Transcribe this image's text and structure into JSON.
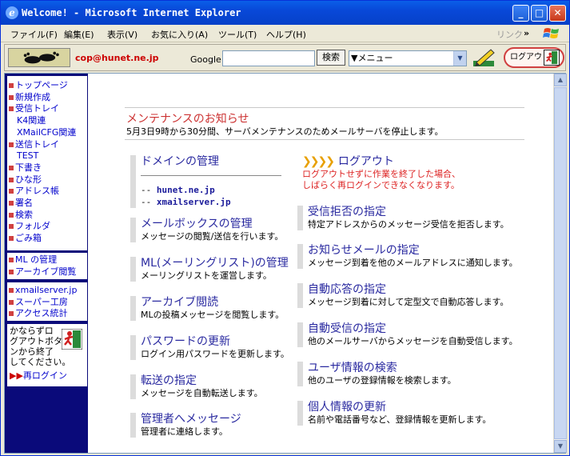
{
  "window": {
    "title": "Welcome! - Microsoft Internet Explorer"
  },
  "menubar": {
    "items": [
      "ファイル(F)",
      "編集(E)",
      "表示(V)",
      "お気に入り(A)",
      "ツール(T)",
      "ヘルプ(H)"
    ],
    "links_label": "リンク",
    "more": "»"
  },
  "toolbar": {
    "email": "cop@hunet.ne.jp",
    "google_label": "Google",
    "search_value": "",
    "search_button": "検索",
    "menu_select": "▼メニュー",
    "logout_label": "ログアウト"
  },
  "sidebar": {
    "group1": [
      {
        "label": "トップページ",
        "bullet": true
      },
      {
        "label": "新規作成",
        "bullet": true
      },
      {
        "label": "受信トレイ",
        "bullet": true
      },
      {
        "label": "K4関連",
        "bullet": false
      },
      {
        "label": "XMailCFG関連",
        "bullet": false
      },
      {
        "label": "送信トレイ",
        "bullet": true
      },
      {
        "label": "TEST",
        "bullet": false
      },
      {
        "label": "下書き",
        "bullet": true
      },
      {
        "label": "ひな形",
        "bullet": true
      },
      {
        "label": "アドレス帳",
        "bullet": true
      },
      {
        "label": "署名",
        "bullet": true
      },
      {
        "label": "検索",
        "bullet": true
      },
      {
        "label": "フォルダ",
        "bullet": true
      },
      {
        "label": "ごみ箱",
        "bullet": true
      }
    ],
    "group2": [
      {
        "label": "ML の管理",
        "bullet": true
      },
      {
        "label": "アーカイブ閲覧",
        "bullet": true
      }
    ],
    "group3": [
      {
        "label": "xmailserver.jp",
        "bullet": true
      },
      {
        "label": "スーパー工房",
        "bullet": true
      },
      {
        "label": "アクセス統計",
        "bullet": true
      }
    ],
    "note_lines": [
      "かならずロ",
      "グアウトボタ",
      "ンから終了",
      "してください。"
    ],
    "relogin_arrow": "▶▶",
    "relogin": "再ログイン"
  },
  "notice": {
    "title": "メンテナンスのお知らせ",
    "text": "5月3日9時から30分間、サーバメンテナンスのためメールサーバを停止します。"
  },
  "left_sections": [
    {
      "title": "ドメインの管理",
      "desc": ""
    },
    {
      "title": "メールボックスの管理",
      "desc": "メッセージの閲覧/送信を行います。"
    },
    {
      "title": "ML(メーリングリスト)の管理",
      "desc": "メーリングリストを運営します。"
    },
    {
      "title": "アーカイブ閲読",
      "desc": "MLの投稿メッセージを閲覧します。"
    },
    {
      "title": "パスワードの更新",
      "desc": "ログイン用パスワードを更新します。"
    },
    {
      "title": "転送の指定",
      "desc": "メッセージを自動転送します。"
    },
    {
      "title": "管理者へメッセージ",
      "desc": "管理者に連絡します。"
    }
  ],
  "domains": [
    {
      "prefix": "-- ",
      "name": "hunet.ne.jp"
    },
    {
      "prefix": "-- ",
      "name": "xmailserver.jp"
    }
  ],
  "logout_section": {
    "chevrons": "❯❯❯❯",
    "title": "ログアウト",
    "desc_lines": [
      "ログアウトせずに作業を終了した場合、",
      "しばらく再ログインできなくなります。"
    ]
  },
  "right_sections": [
    {
      "title": "受信拒否の指定",
      "desc": "特定アドレスからのメッセージ受信を拒否します。"
    },
    {
      "title": "お知らせメールの指定",
      "desc": "メッセージ到着を他のメールアドレスに通知します。"
    },
    {
      "title": "自動応答の指定",
      "desc": "メッセージ到着に対して定型文で自動応答します。"
    },
    {
      "title": "自動受信の指定",
      "desc": "他のメールサーバからメッセージを自動受信します。"
    },
    {
      "title": "ユーザ情報の検索",
      "desc": "他のユーザの登録情報を検索します。"
    },
    {
      "title": "個人情報の更新",
      "desc": "名前や電話番号など、登録情報を更新します。"
    }
  ]
}
